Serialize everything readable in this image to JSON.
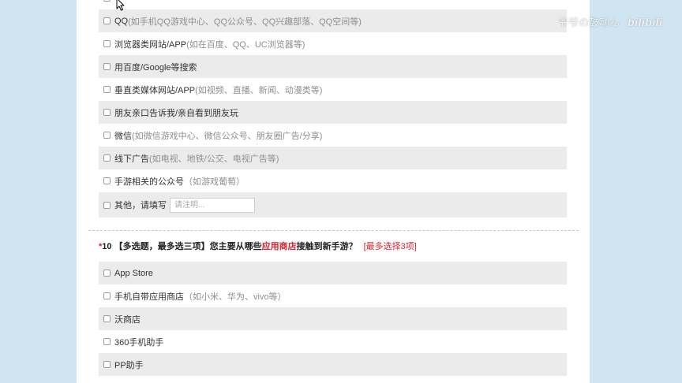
{
  "watermark": {
    "text": "爷爷の鼓动ん",
    "brand": "bilibili"
  },
  "colors": {
    "page_bg": "#cfe5f1",
    "panel_bg": "#ffffff",
    "row_alt_bg": "#ebebeb",
    "accent_red": "#d9232d",
    "hint_grey": "#8e8e8e"
  },
  "prev_question": {
    "options": [
      {
        "label": "QQ",
        "hint": "(如手机QQ游戏中心、QQ公众号、QQ兴趣部落、QQ空间等)"
      },
      {
        "label": "浏览器类网站/APP",
        "hint": "(如在百度、QQ、UC浏览器等)"
      },
      {
        "label": "用百度/Google等搜索",
        "hint": ""
      },
      {
        "label": "垂直类媒体网站/APP",
        "hint": "(如视频、直播、新闻、动漫类等)"
      },
      {
        "label": "朋友亲口告诉我/亲自看到朋友玩",
        "hint": ""
      },
      {
        "label": "微信",
        "hint": "(如微信游戏中心、微信公众号、朋友圈广告/分享)"
      },
      {
        "label": "线下广告",
        "hint": "(如电视、地铁/公交、电视广告等)"
      },
      {
        "label": "手游相关的公众号",
        "hint": "（如游戏葡萄）"
      }
    ],
    "other": {
      "label": "其他，请填写",
      "value": "",
      "placeholder": "请注明..."
    }
  },
  "question10": {
    "required_mark": "*",
    "number": "10",
    "title_part1": " 【多选题，最多选三项】您主要从哪些",
    "title_highlight": "应用商店",
    "title_part2": "接触到新手游？",
    "limit_note": "[最多选择3项]",
    "options": [
      {
        "label": "App Store",
        "hint": ""
      },
      {
        "label": "手机自带应用商店",
        "hint": "（如小米、华为、vivo等）"
      },
      {
        "label": "沃商店",
        "hint": ""
      },
      {
        "label": "360手机助手",
        "hint": ""
      },
      {
        "label": "PP助手",
        "hint": ""
      }
    ]
  },
  "icons": {
    "cursor": "mouse-cursor-icon",
    "checkbox": "checkbox-unchecked"
  }
}
